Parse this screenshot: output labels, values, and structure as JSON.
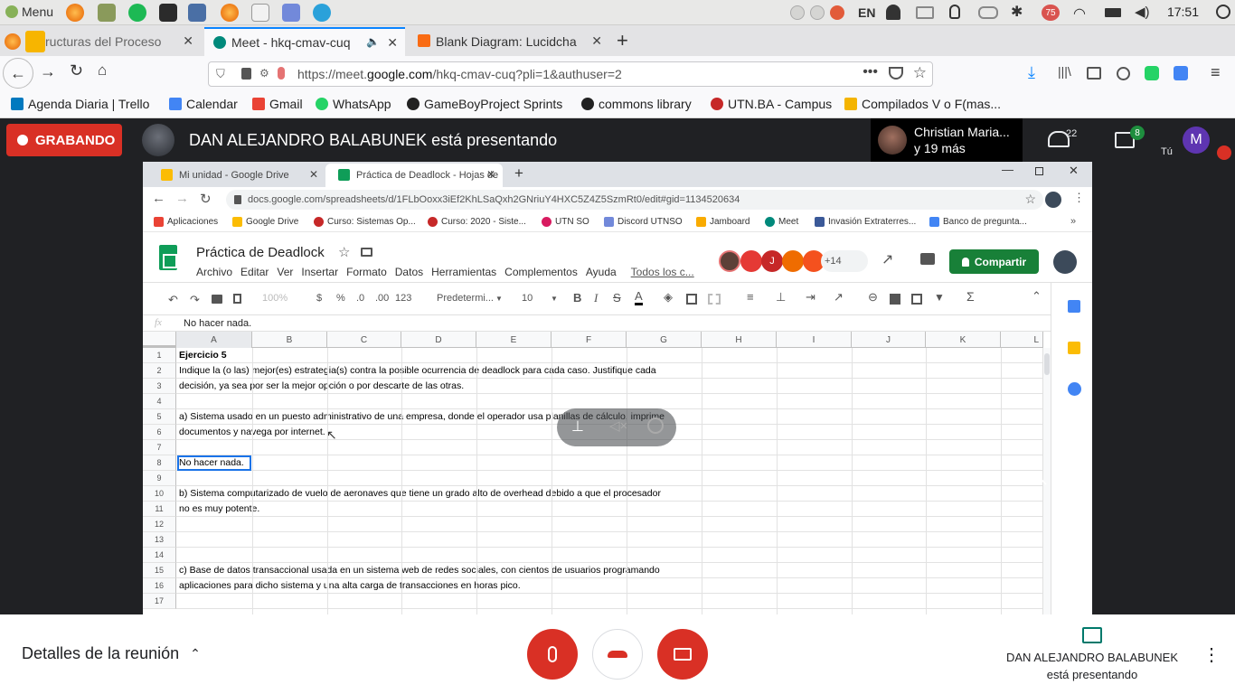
{
  "os_panel": {
    "menu_label": "Menu",
    "keyboard_layout": "EN",
    "badge_count": "75",
    "clock": "17:51"
  },
  "firefox": {
    "tabs": [
      {
        "label": "ructuras del Proceso"
      },
      {
        "label": "Meet - hkq-cmav-cuq"
      },
      {
        "label": "Blank Diagram: Lucidcha"
      }
    ],
    "url_prefix": "https://meet.",
    "url_domain": "google.com",
    "url_suffix": "/hkq-cmav-cuq?pli=1&authuser=2",
    "bookmarks": [
      {
        "label": "Agenda Diaria | Trello",
        "color": "#0079bf"
      },
      {
        "label": "Calendar",
        "color": "#4285f4"
      },
      {
        "label": "Gmail",
        "color": "#ea4335"
      },
      {
        "label": "WhatsApp",
        "color": "#25d366"
      },
      {
        "label": "GameBoyProject Sprints",
        "color": "#222222"
      },
      {
        "label": "commons library",
        "color": "#222222"
      },
      {
        "label": "UTN.BA - Campus",
        "color": "#c62828"
      },
      {
        "label": "Compilados V o F(mas...",
        "color": "#f4b400"
      }
    ]
  },
  "meet": {
    "recording_label": "GRABANDO",
    "presenting_text": "DAN ALEJANDRO BALABUNEK está presentando",
    "participant_name": "Christian Maria...",
    "participant_more": "y 19 más",
    "people_count": "22",
    "chat_count": "8",
    "self_label": "Tú",
    "self_initial": "M",
    "meeting_details": "Detalles de la reunión",
    "presenter_line1": "DAN ALEJANDRO BALABUNEK",
    "presenter_line2": "está presentando"
  },
  "shared": {
    "tabs": [
      {
        "label": "Mi unidad - Google Drive"
      },
      {
        "label": "Práctica de Deadlock - Hojas de"
      }
    ],
    "url": "docs.google.com/spreadsheets/d/1FLbOoxx3iEf2KhLSaQxh2GNriuY4HXC5Z4Z5SzmRt0/edit#gid=1134520634",
    "bookmarks": [
      {
        "label": "Aplicaciones",
        "color": "#ea4335"
      },
      {
        "label": "Google Drive",
        "color": "#fbbc04"
      },
      {
        "label": "Curso: Sistemas Op...",
        "color": "#c62828"
      },
      {
        "label": "Curso: 2020 - Siste...",
        "color": "#c62828"
      },
      {
        "label": "UTN SO",
        "color": "#d81b60"
      },
      {
        "label": "Discord UTNSO",
        "color": "#7289da"
      },
      {
        "label": "Jamboard",
        "color": "#f9ab00"
      },
      {
        "label": "Meet",
        "color": "#00897b"
      },
      {
        "label": "Invasión Extraterres...",
        "color": "#3b5998"
      },
      {
        "label": "Banco de pregunta...",
        "color": "#4285f4"
      }
    ],
    "doc_title": "Práctica de Deadlock",
    "menus": [
      "Archivo",
      "Editar",
      "Ver",
      "Insertar",
      "Formato",
      "Datos",
      "Herramientas",
      "Complementos",
      "Ayuda",
      "Todos los c..."
    ],
    "collab_more": "+14",
    "share_label": "Compartir",
    "toolbar": {
      "zoom": "100%",
      "currency": "$",
      "percent": "%",
      "dec_less": ".0",
      "dec_more": ".00",
      "format": "123",
      "font": "Predetermi...",
      "size": "10"
    },
    "fx": "fx",
    "formula": "No hacer nada.",
    "columns": [
      "A",
      "B",
      "C",
      "D",
      "E",
      "F",
      "G",
      "H",
      "I",
      "J",
      "K",
      "L"
    ],
    "rows": [
      {
        "n": "1",
        "text": "Ejercicio 5"
      },
      {
        "n": "2",
        "text": "Indique la (o las) mejor(es) estrategia(s) contra la posible ocurrencia de deadlock para cada caso. Justifique cada"
      },
      {
        "n": "3",
        "text": "decisión, ya sea por ser la mejor opción o por descarte de las otras."
      },
      {
        "n": "4",
        "text": ""
      },
      {
        "n": "5",
        "text": "a) Sistema usado en un puesto administrativo de una empresa, donde el operador usa planillas de cálculo, imprime"
      },
      {
        "n": "6",
        "text": "documentos y navega por internet."
      },
      {
        "n": "7",
        "text": ""
      },
      {
        "n": "8",
        "text": "No hacer nada."
      },
      {
        "n": "9",
        "text": ""
      },
      {
        "n": "10",
        "text": "b) Sistema computarizado de vuelo de aeronaves que tiene un grado alto de overhead debido a que el procesador"
      },
      {
        "n": "11",
        "text": "no es muy potente."
      },
      {
        "n": "12",
        "text": ""
      },
      {
        "n": "13",
        "text": ""
      },
      {
        "n": "14",
        "text": ""
      },
      {
        "n": "15",
        "text": "c) Base de datos transaccional usada en un sistema web de redes sociales, con cientos de usuarios programando"
      },
      {
        "n": "16",
        "text": "aplicaciones para dicho sistema y una alta carga de transacciones en horas pico."
      },
      {
        "n": "17",
        "text": ""
      }
    ]
  },
  "colors": {
    "recording": "#d93025",
    "meet_dark": "#202124",
    "share_green": "#188038",
    "sheets_green": "#0f9d58",
    "selection_blue": "#1a73e8"
  }
}
